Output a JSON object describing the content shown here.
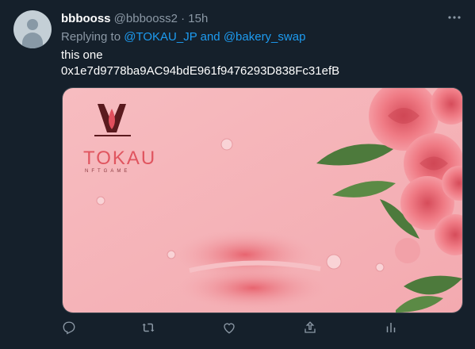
{
  "tweet": {
    "name": "bbbooss",
    "handle": "@bbbooss2",
    "dot": "·",
    "time": "15h",
    "replying_prefix": "Replying to",
    "mention1": "@TOKAU_JP",
    "and": "and",
    "mention2": "@bakery_swap",
    "text_line1": "this one",
    "text_line2": "0x1e7d9778ba9AC94bdE961f9476293D838Fc31efB"
  },
  "media": {
    "logo_text": "TOKAU",
    "logo_sub": "NFTGAME",
    "bg_color": "#f4b3b8"
  },
  "icons": [
    "more-icon",
    "reply-icon",
    "retweet-icon",
    "like-icon",
    "share-icon",
    "analytics-icon"
  ],
  "colors": {
    "background": "#15202b",
    "accent": "#1d9bf0",
    "muted": "#8b98a5"
  }
}
